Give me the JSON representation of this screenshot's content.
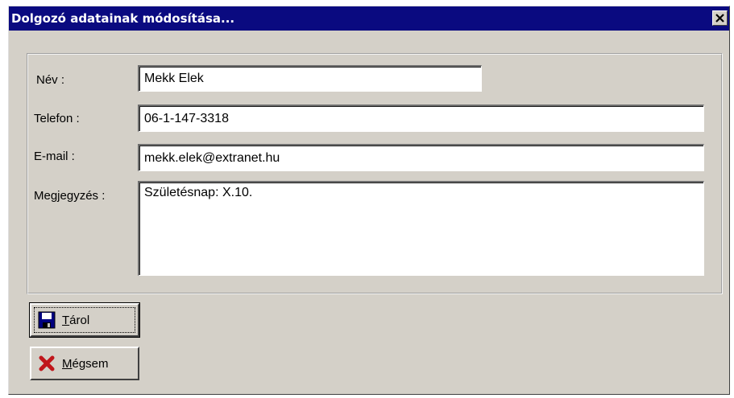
{
  "window": {
    "title": "Dolgozó adatainak módosítása...",
    "close_glyph": "✕"
  },
  "form": {
    "name_label": "Név :",
    "name_value": "Mekk Elek",
    "phone_label": "Telefon :",
    "phone_value": "06-1-147-3318",
    "email_label": "E-mail :",
    "email_value": "mekk.elek@extranet.hu",
    "note_label": "Megjegyzés :",
    "note_value": "Születésnap: X.10."
  },
  "buttons": {
    "save_label": "Tárol",
    "save_icon": "floppy-disk-icon",
    "cancel_label": "Mégsem",
    "cancel_icon": "red-x-icon"
  },
  "colors": {
    "titlebar": "#0a0a80",
    "face": "#d4d0c8",
    "cancel_icon": "#c0161b"
  }
}
